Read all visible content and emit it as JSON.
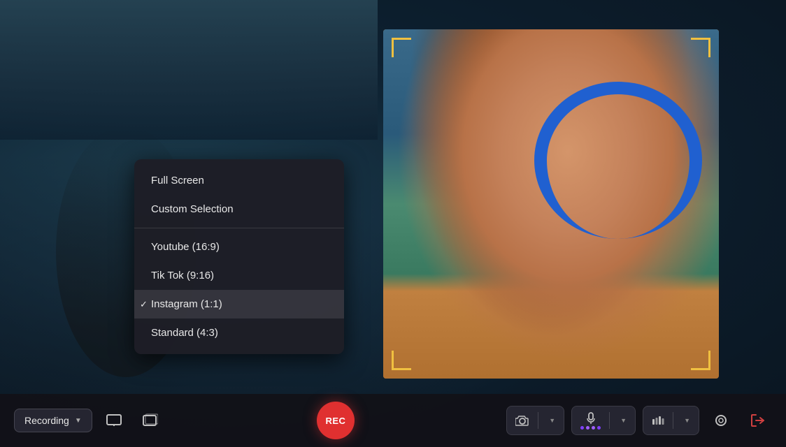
{
  "background": {
    "color": "#1a2a2a"
  },
  "dropdown": {
    "items": [
      {
        "id": "full-screen",
        "label": "Full Screen",
        "checked": false,
        "dividerAfter": false
      },
      {
        "id": "custom-selection",
        "label": "Custom Selection",
        "checked": false,
        "dividerAfter": true
      },
      {
        "id": "youtube",
        "label": "Youtube (16:9)",
        "checked": false,
        "dividerAfter": false
      },
      {
        "id": "tiktok",
        "label": "Tik Tok (9:16)",
        "checked": false,
        "dividerAfter": false
      },
      {
        "id": "instagram",
        "label": "Instagram (1:1)",
        "checked": true,
        "dividerAfter": false
      },
      {
        "id": "standard",
        "label": "Standard (4:3)",
        "checked": false,
        "dividerAfter": false
      }
    ]
  },
  "toolbar": {
    "recording_label": "Recording",
    "rec_label": "REC",
    "screen_icon": "⬜",
    "window_icon": "▣",
    "camera_icon": "⊙",
    "mic_icon": "🎤",
    "audio_icon": "📊",
    "settings_icon": "⊕",
    "exit_icon": "⎋"
  }
}
